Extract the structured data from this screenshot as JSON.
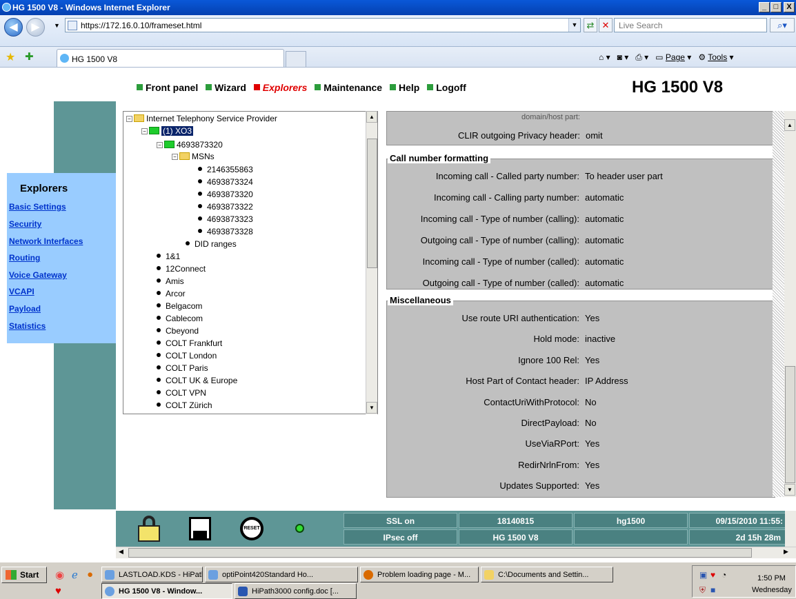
{
  "window": {
    "title": "HG 1500 V8 - Windows Internet Explorer",
    "min": "_",
    "max": "□",
    "close": "X"
  },
  "browser": {
    "back": "◀",
    "forward": "▶",
    "address": "https://172.16.0.10/frameset.html",
    "search_placeholder": "Live Search",
    "tab_title": "HG 1500 V8",
    "page_label": "Page",
    "tools_label": "Tools"
  },
  "app": {
    "brand": "HG 1500 V8",
    "menu": [
      "Front panel",
      "Wizard",
      "Explorers",
      "Maintenance",
      "Help",
      "Logoff"
    ],
    "active_menu": "Explorers"
  },
  "sidebar": {
    "title": "Explorers",
    "links": [
      "Basic Settings",
      "Security",
      "Network Interfaces",
      "Routing",
      "Voice Gateway",
      "VCAPI",
      "Payload",
      "Statistics"
    ]
  },
  "tree": {
    "root": "Internet Telephony Service Provider",
    "provider": "(1) XO3",
    "number": "4693873320",
    "msns_label": "MSNs",
    "msns": [
      "2146355863",
      "4693873324",
      "4693873320",
      "4693873322",
      "4693873323",
      "4693873328"
    ],
    "did": "DID ranges",
    "providers": [
      "1&1",
      "12Connect",
      "Amis",
      "Arcor",
      "Belgacom",
      "Cablecom",
      "Cbeyond",
      "COLT Frankfurt",
      "COLT London",
      "COLT Paris",
      "COLT UK & Europe",
      "COLT VPN",
      "COLT Zürich"
    ]
  },
  "details": {
    "cut_label": "domain/host part:",
    "clir_label": "CLIR outgoing Privacy header:",
    "clir_value": "omit",
    "call_number_title": "Call number formatting",
    "call_number_rows": [
      {
        "label": "Incoming call - Called party number:",
        "value": "To header user part"
      },
      {
        "label": "Incoming call - Calling party number:",
        "value": "automatic"
      },
      {
        "label": "Incoming call - Type of number (calling):",
        "value": "automatic"
      },
      {
        "label": "Outgoing call - Type of number (calling):",
        "value": "automatic"
      },
      {
        "label": "Incoming call - Type of number (called):",
        "value": "automatic"
      },
      {
        "label": "Outgoing call - Type of number (called):",
        "value": "automatic"
      }
    ],
    "misc_title": "Miscellaneous",
    "misc_rows": [
      {
        "label": "Use route URI authentication:",
        "value": "Yes"
      },
      {
        "label": "Hold mode:",
        "value": "inactive"
      },
      {
        "label": "Ignore 100 Rel:",
        "value": "Yes"
      },
      {
        "label": "Host Part of Contact header:",
        "value": "IP Address"
      },
      {
        "label": "ContactUriWithProtocol:",
        "value": "No"
      },
      {
        "label": "DirectPayload:",
        "value": "No"
      },
      {
        "label": "UseViaRPort:",
        "value": "Yes"
      },
      {
        "label": "RedirNrlnFrom:",
        "value": "Yes"
      },
      {
        "label": "Updates Supported:",
        "value": "Yes"
      }
    ]
  },
  "status": {
    "reset_label": "RESET",
    "row1": [
      "SSL on",
      "18140815",
      "hg1500",
      "09/15/2010 11:55:"
    ],
    "row2": [
      "IPsec off",
      "HG 1500 V8",
      "",
      "2d 15h 28m"
    ]
  },
  "taskbar": {
    "start": "Start",
    "top": [
      "LASTLOAD.KDS - HiPath ...",
      "optiPoint420Standard Ho...",
      "Problem loading page - M...",
      "C:\\Documents and Settin..."
    ],
    "bottom": [
      "HG 1500 V8 - Window...",
      "HiPath3000 config.doc [..."
    ],
    "time": "1:50 PM",
    "day": "Wednesday"
  }
}
